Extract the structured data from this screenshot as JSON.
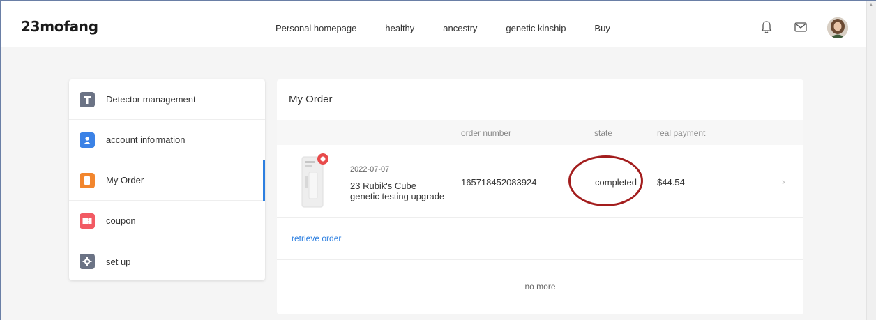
{
  "header": {
    "logo": "23mofang",
    "nav": [
      "Personal homepage",
      "healthy",
      "ancestry",
      "genetic kinship",
      "Buy"
    ],
    "icons": [
      "bell-icon",
      "mail-icon"
    ],
    "avatar": "user-avatar"
  },
  "sidebar": {
    "items": [
      {
        "label": "Detector management",
        "icon": "detector-icon",
        "color": "#6b7385"
      },
      {
        "label": "account information",
        "icon": "person-icon",
        "color": "#3b82e6"
      },
      {
        "label": "My Order",
        "icon": "order-icon",
        "color": "#f2862e",
        "active": true
      },
      {
        "label": "coupon",
        "icon": "coupon-icon",
        "color": "#f25a63"
      },
      {
        "label": "set up",
        "icon": "gear-icon",
        "color": "#6b7385"
      }
    ]
  },
  "main": {
    "title": "My Order",
    "columns": {
      "order_number": "order number",
      "state": "state",
      "real_payment": "real payment"
    },
    "order": {
      "date": "2022-07-07",
      "name": "23 Rubik's Cube genetic testing upgrade",
      "number": "165718452083924",
      "state": "completed",
      "payment": "$44.54"
    },
    "retrieve": "retrieve order",
    "no_more": "no more"
  },
  "colors": {
    "accent": "#2d7fe0",
    "highlight": "#a31d1d"
  }
}
